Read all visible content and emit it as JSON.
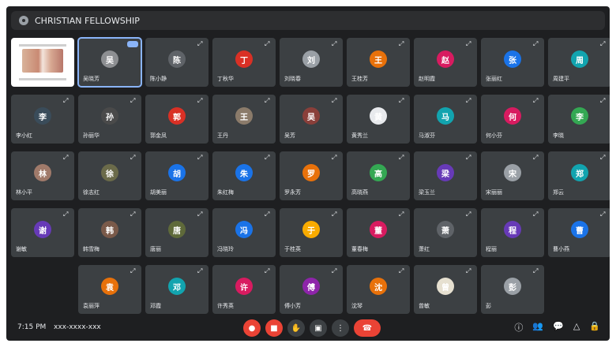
{
  "meeting": {
    "title": "CHRISTIAN FELLOWSHIP",
    "time": "7:15 PM",
    "meeting_code": "xxx-xxxx-xxx"
  },
  "participants": [
    {
      "name": "",
      "type": "screen"
    },
    {
      "name": "吴晓芳",
      "color": "#8d8f92",
      "active": true
    },
    {
      "name": "陈小静",
      "color": "#5f6368"
    },
    {
      "name": "丁秋华",
      "color": "#d93025"
    },
    {
      "name": "刘晓春",
      "color": "#9aa0a6"
    },
    {
      "name": "王桂芳",
      "color": "#e8710a"
    },
    {
      "name": "赵明霞",
      "color": "#d81b60"
    },
    {
      "name": "张丽红",
      "color": "#1a73e8"
    },
    {
      "name": "周建平",
      "color": "#12a4af"
    },
    {
      "name": "李小红",
      "color": "#3a4c5a"
    },
    {
      "name": "孙丽华",
      "color": "#4a4a4a"
    },
    {
      "name": "郭金凤",
      "color": "#d93025"
    },
    {
      "name": "王丹",
      "color": "#8b7b6a"
    },
    {
      "name": "吴芳",
      "color": "#8a3f3a"
    },
    {
      "name": "黄秀兰",
      "color": "#e8eaed"
    },
    {
      "name": "马淑芬",
      "color": "#12a4af"
    },
    {
      "name": "何小芬",
      "color": "#d81b60"
    },
    {
      "name": "李晓",
      "color": "#34a853"
    },
    {
      "name": "林小平",
      "color": "#a07a6a"
    },
    {
      "name": "徐志红",
      "color": "#6b6b4a"
    },
    {
      "name": "胡美丽",
      "color": "#1a73e8"
    },
    {
      "name": "朱红梅",
      "color": "#1a73e8"
    },
    {
      "name": "罗永芳",
      "color": "#e8710a"
    },
    {
      "name": "高晓燕",
      "color": "#34a853"
    },
    {
      "name": "梁玉兰",
      "color": "#673ab7"
    },
    {
      "name": "宋丽丽",
      "color": "#9aa0a6"
    },
    {
      "name": "郑云",
      "color": "#12a4af"
    },
    {
      "name": "谢敏",
      "color": "#673ab7"
    },
    {
      "name": "韩雪梅",
      "color": "#7a5a4a"
    },
    {
      "name": "唐丽",
      "color": "#5f6a3a"
    },
    {
      "name": "冯晓玲",
      "color": "#1a73e8"
    },
    {
      "name": "于桂英",
      "color": "#f9ab00"
    },
    {
      "name": "董春梅",
      "color": "#d81b60"
    },
    {
      "name": "萧红",
      "color": "#5f6368"
    },
    {
      "name": "程丽",
      "color": "#673ab7"
    },
    {
      "name": "曹小燕",
      "color": "#1a73e8"
    },
    {
      "name": "袁丽萍",
      "color": "#e8710a"
    },
    {
      "name": "邓霞",
      "color": "#12a4af"
    },
    {
      "name": "许秀英",
      "color": "#d81b60"
    },
    {
      "name": "傅小芳",
      "color": "#8e24aa"
    },
    {
      "name": "沈琴",
      "color": "#e8710a"
    },
    {
      "name": "曾敏",
      "color": "#e6e0d0"
    },
    {
      "name": "彭",
      "color": "#9aa0a6"
    }
  ]
}
